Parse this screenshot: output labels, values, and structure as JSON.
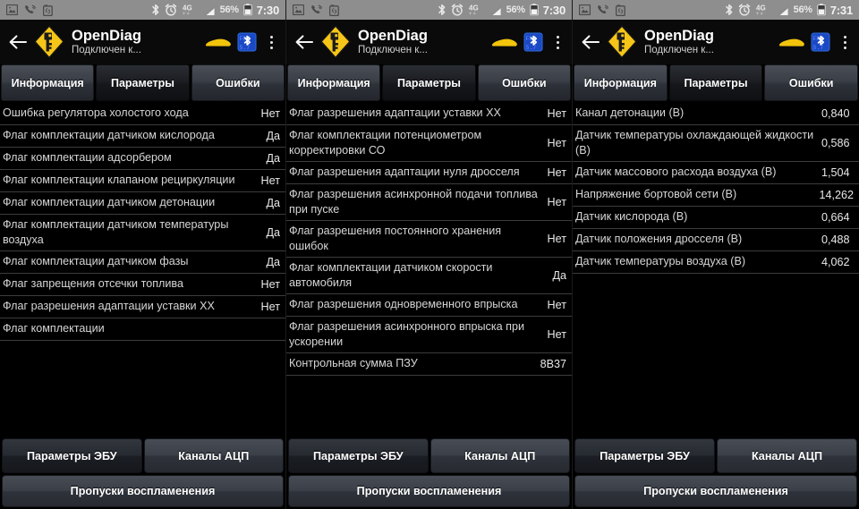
{
  "app": {
    "title": "OpenDiag",
    "subtitle": "Подключен к...",
    "icons": {
      "back": "back-arrow-icon",
      "logo": "opendiag-logo-icon",
      "car": "car-icon",
      "bluetooth": "bluetooth-icon",
      "overflow": "overflow-menu-icon"
    }
  },
  "statusbar": {
    "battery_percent": "56%",
    "network": "4G",
    "icons": [
      "image-icon",
      "phone-muted-icon",
      "battery-saver-icon",
      "bluetooth-status-icon",
      "alarm-icon",
      "signal-icon",
      "battery-icon"
    ]
  },
  "tabs": {
    "labels": [
      "Информация",
      "Параметры",
      "Ошибки"
    ],
    "selected_index": 1
  },
  "bottom": {
    "buttons": [
      "Параметры ЭБУ",
      "Каналы АЦП"
    ],
    "raised_index": 1,
    "wide_button": "Пропуски воспламенения"
  },
  "panels": [
    {
      "time": "7:30",
      "kind": "ecu-params",
      "rows": [
        {
          "name": "Ошибка регулятора холостого хода",
          "value": "Нет"
        },
        {
          "name": "Флаг комплектации датчиком кислорода",
          "value": "Да"
        },
        {
          "name": "Флаг комплектации адсорбером",
          "value": "Да"
        },
        {
          "name": "Флаг комплектации клапаном рециркуляции",
          "value": "Нет"
        },
        {
          "name": "Флаг комплектации датчиком детонации",
          "value": "Да"
        },
        {
          "name": "Флаг комплектации датчиком температуры воздуха",
          "value": "Да"
        },
        {
          "name": "Флаг комплектации датчиком фазы",
          "value": "Да"
        },
        {
          "name": "Флаг запрещения отсечки топлива",
          "value": "Нет"
        },
        {
          "name": "Флаг разрешения адаптации уставки ХХ",
          "value": "Нет"
        },
        {
          "name": "Флаг комплектации",
          "value": ""
        }
      ]
    },
    {
      "time": "7:30",
      "kind": "ecu-params",
      "rows": [
        {
          "name": "Флаг разрешения адаптации уставки ХХ",
          "value": "Нет"
        },
        {
          "name": "Флаг комплектации потенциометром корректировки СО",
          "value": "Нет"
        },
        {
          "name": "Флаг разрешения адаптации нуля дросселя",
          "value": "Нет"
        },
        {
          "name": "Флаг разрешения асинхронной подачи топлива при пуске",
          "value": "Нет"
        },
        {
          "name": "Флаг разрешения постоянного хранения ошибок",
          "value": "Нет"
        },
        {
          "name": "Флаг комплектации датчиком скорости автомобиля",
          "value": "Да"
        },
        {
          "name": "Флаг разрешения одновременного впрыска",
          "value": "Нет"
        },
        {
          "name": "Флаг разрешения асинхронного впрыска при ускорении",
          "value": "Нет"
        },
        {
          "name": "Контрольная сумма ПЗУ",
          "value": "8B37"
        }
      ]
    },
    {
      "time": "7:31",
      "kind": "adc-channels",
      "rows": [
        {
          "name": "Канал детонации (В)",
          "value": "0,840"
        },
        {
          "name": "Датчик температуры охлаждающей жидкости (В)",
          "value": "0,586"
        },
        {
          "name": "Датчик массового расхода воздуха (В)",
          "value": "1,504"
        },
        {
          "name": "Напряжение бортовой сети (В)",
          "value": "14,262"
        },
        {
          "name": "Датчик кислорода (В)",
          "value": "0,664"
        },
        {
          "name": "Датчик положения дросселя (В)",
          "value": "0,488"
        },
        {
          "name": "Датчик температуры воздуха (В)",
          "value": "4,062"
        }
      ]
    }
  ]
}
